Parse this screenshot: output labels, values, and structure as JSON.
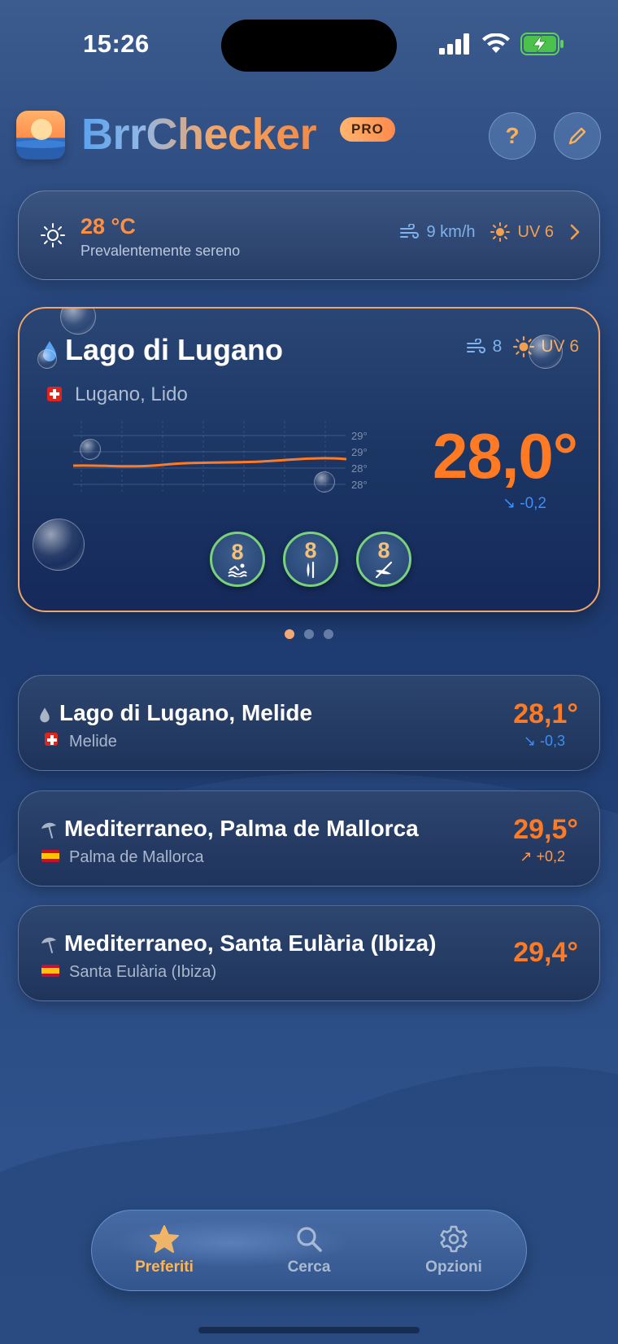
{
  "status_bar": {
    "time": "15:26"
  },
  "header": {
    "app_name_part1": "Brr",
    "app_name_part2": "Checker",
    "badge": "PRO",
    "help_label": "?"
  },
  "weather": {
    "temp": "28 °C",
    "description": "Prevalentemente sereno",
    "wind": "9 km/h",
    "uv": "UV 6"
  },
  "main_card": {
    "title": "Lago di Lugano",
    "subtitle": "Lugano, Lido",
    "wind": "8",
    "uv": "UV 6",
    "temp": "28,0°",
    "delta": "↘ -0,2",
    "chart_labels": [
      "29°",
      "29°",
      "28°",
      "28°"
    ],
    "scores": [
      {
        "value": "8",
        "icon": "swimmer-icon"
      },
      {
        "value": "8",
        "icon": "paddle-icon"
      },
      {
        "value": "8",
        "icon": "kayak-icon"
      }
    ]
  },
  "pagination": {
    "count": 3,
    "active": 0
  },
  "list": [
    {
      "title": "Lago di Lugano, Melide",
      "subtitle": "Melide",
      "temp": "28,1°",
      "delta": "↘ -0,3",
      "trend": "down",
      "type": "lake",
      "flag": "CH"
    },
    {
      "title": "Mediterraneo, Palma de Mallorca",
      "subtitle": "Palma de Mallorca",
      "temp": "29,5°",
      "delta": "↗ +0,2",
      "trend": "up",
      "type": "sea",
      "flag": "ES"
    },
    {
      "title": "Mediterraneo, Santa Eulària (Ibiza)",
      "subtitle": "Santa Eulària (Ibiza)",
      "temp": "29,4°",
      "delta": "",
      "trend": "none",
      "type": "sea",
      "flag": "ES"
    }
  ],
  "tabs": [
    {
      "label": "Preferiti",
      "icon": "star-icon",
      "active": true
    },
    {
      "label": "Cerca",
      "icon": "search-icon",
      "active": false
    },
    {
      "label": "Opzioni",
      "icon": "gear-icon",
      "active": false
    }
  ],
  "colors": {
    "accent": "#ff7a22",
    "trend_down": "#3d8ff5",
    "tab_active": "#ffb552",
    "card_border": "#f2a56b"
  }
}
